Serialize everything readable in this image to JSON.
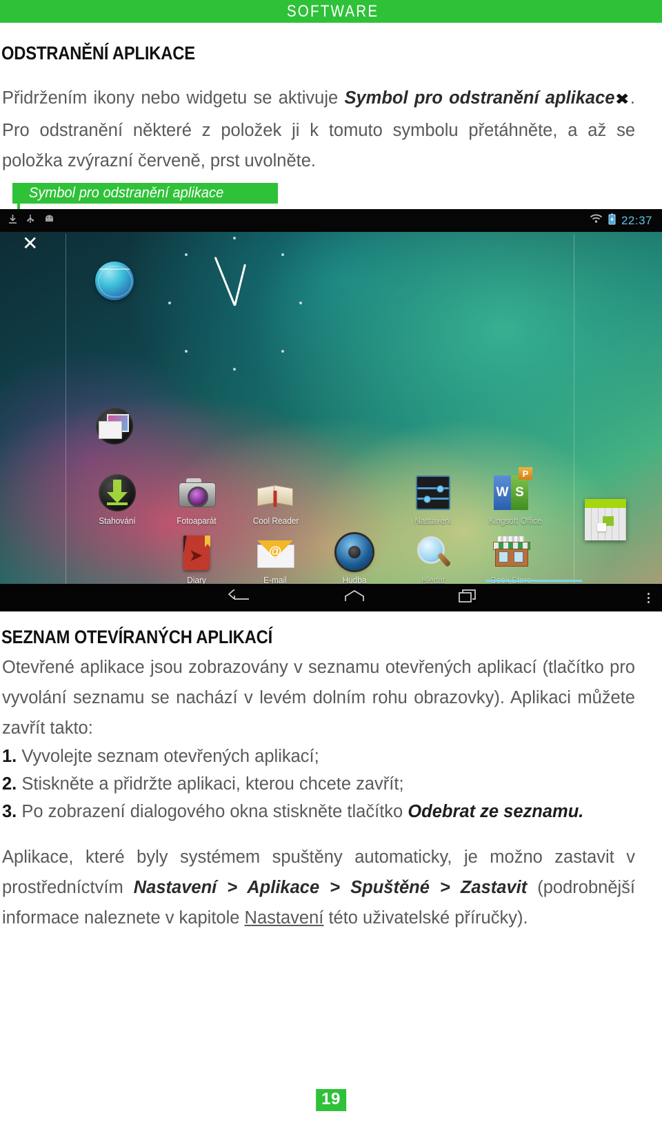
{
  "header": {
    "title": "SOFTWARE",
    "accent": "#2fc138"
  },
  "headings": {
    "h1": "ODSTRANĚNÍ APLIKACE",
    "h2": "SEZNAM OTEVÍRANÝCH APLIKACÍ"
  },
  "paragraphs": {
    "intro_part1": "Přidržením ikony nebo widgetu se aktivuje ",
    "intro_em1": "Symbol pro odstranění aplikace",
    "intro_x": "✖",
    "intro_part2": ". Pro odstranění některé z položek ji k tomuto symbolu přetáhněte, a až se položka zvýrazní červeně, prst uvolněte.",
    "list_intro": "Otevřené aplikace jsou zobrazovány v seznamu otevřených aplikací (tlačítko pro vyvolání seznamu se nachází v levém dolním rohu obrazovky). Aplikaci můžete zavřít takto:",
    "outro_part1": "Aplikace, které byly systémem spuštěny automaticky, je možno zastavit v prostředníctvím ",
    "outro_path1": "Nastavení",
    "outro_sep1": " > ",
    "outro_path2": "Aplikace",
    "outro_sep2": " > ",
    "outro_path3": "Spuštěné",
    "outro_sep3": " > ",
    "outro_path4": "Zastavit",
    "outro_part2": " (podrobnější informace naleznete v kapitole ",
    "outro_link": "Nastavení",
    "outro_part3": " této uživatelské příručky)."
  },
  "steps": [
    {
      "num": "1.",
      "text": "Vyvolejte seznam otevřených aplikací;"
    },
    {
      "num": "2.",
      "text": "Stiskněte a přidržte aplikaci, kterou chcete zavřít;"
    },
    {
      "num": "3.",
      "text": "Po zobrazení dialogového okna stiskněte tlačítko ",
      "em": "Odebrat ze seznamu.",
      "tail": ""
    }
  ],
  "callout": {
    "label": "Symbol pro odstranění aplikace"
  },
  "tablet": {
    "statusbar": {
      "clock": "22:37"
    },
    "removal_symbol": "✕",
    "apps_row1": [
      {
        "label": "Stahování",
        "icon": "download-icon"
      },
      {
        "label": "Fotoaparát",
        "icon": "camera-icon"
      },
      {
        "label": "Cool Reader",
        "icon": "open-book-icon"
      },
      {
        "label": "Nastavení",
        "icon": "settings-sliders-icon"
      },
      {
        "label": "Kingsoft Office",
        "icon": "kingsoft-office-icon"
      }
    ],
    "apps_row2": [
      {
        "label": "Diary",
        "icon": "diary-icon"
      },
      {
        "label": "E-mail",
        "icon": "envelope-icon"
      },
      {
        "label": "Hudba",
        "icon": "speaker-icon"
      },
      {
        "label": "Hledat",
        "icon": "magnifier-icon"
      },
      {
        "label": "Book Store",
        "icon": "storefront-icon"
      }
    ],
    "kingsoft_letters": {
      "w": "W",
      "s": "S",
      "p": "P"
    },
    "calculator": {
      "minus": "−",
      "plus": "+",
      "equals": "="
    },
    "email_at": "@",
    "diary_arrow": "➤"
  },
  "footer": {
    "page_number": "19"
  }
}
